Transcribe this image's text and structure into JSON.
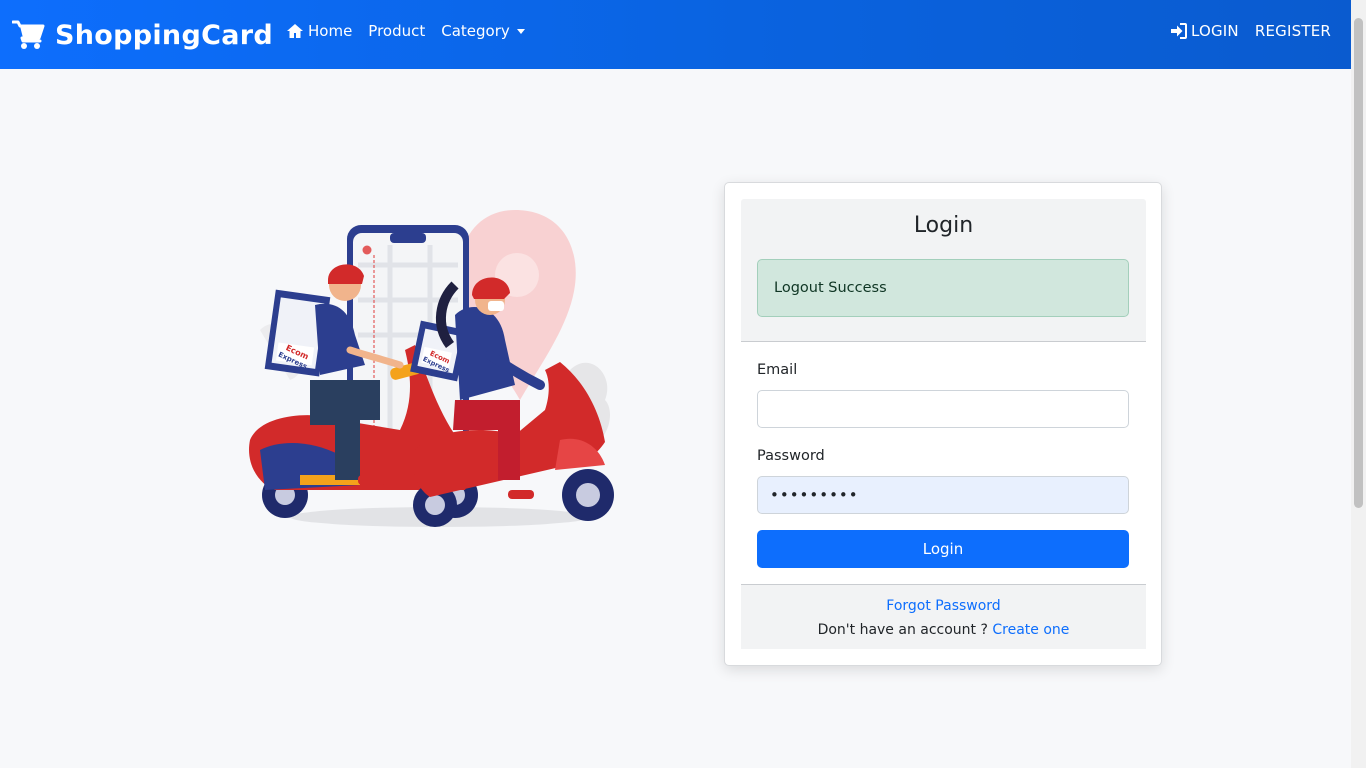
{
  "navbar": {
    "brand": "ShoppingCard",
    "links": {
      "home": "Home",
      "product": "Product",
      "category": "Category"
    },
    "login": "LOGIN",
    "register": "REGISTER",
    "gradient_from": "#0d6efd",
    "gradient_to": "#0a5bcf"
  },
  "illustration": {
    "box_label_line1": "Ecom",
    "box_label_line2": "Express"
  },
  "login_card": {
    "title": "Login",
    "alert": "Logout Success",
    "email_label": "Email",
    "email_value": "",
    "password_label": "Password",
    "password_value": "•••••••••",
    "submit_label": "Login",
    "forgot_password": "Forgot Password",
    "no_account_text": "Don't have an account ?",
    "create_link": "Create one"
  },
  "colors": {
    "primary": "#0d6efd",
    "alert_bg": "#d1e7dd",
    "page_bg": "#f7f8fa"
  }
}
